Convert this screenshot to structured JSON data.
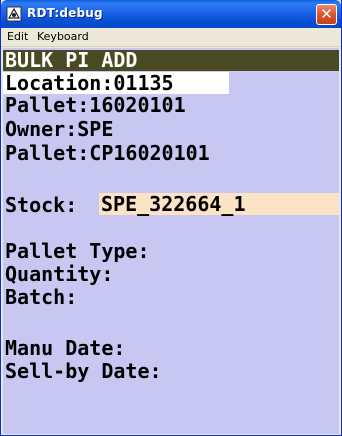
{
  "window": {
    "title": "RDT:debug",
    "close_glyph": "✕"
  },
  "menu": {
    "items": [
      "Edit",
      "Keyboard"
    ]
  },
  "screen": {
    "heading": "BULK PI ADD",
    "location": "Location:01135",
    "pallet": "Pallet:16020101",
    "owner": "Owner:SPE",
    "pallet_cp": "Pallet:CP16020101",
    "stock_label": "Stock:",
    "stock_value": "SPE_322664_1",
    "pallet_type": "Pallet Type:",
    "quantity": "Quantity:",
    "batch": "Batch:",
    "manu_date": "Manu Date:",
    "sell_by_date": "Sell-by Date:"
  },
  "colors": {
    "screen_bg": "#c7c7f2",
    "heading_bg": "#4a4a22",
    "input_bg": "#fde3c6"
  }
}
